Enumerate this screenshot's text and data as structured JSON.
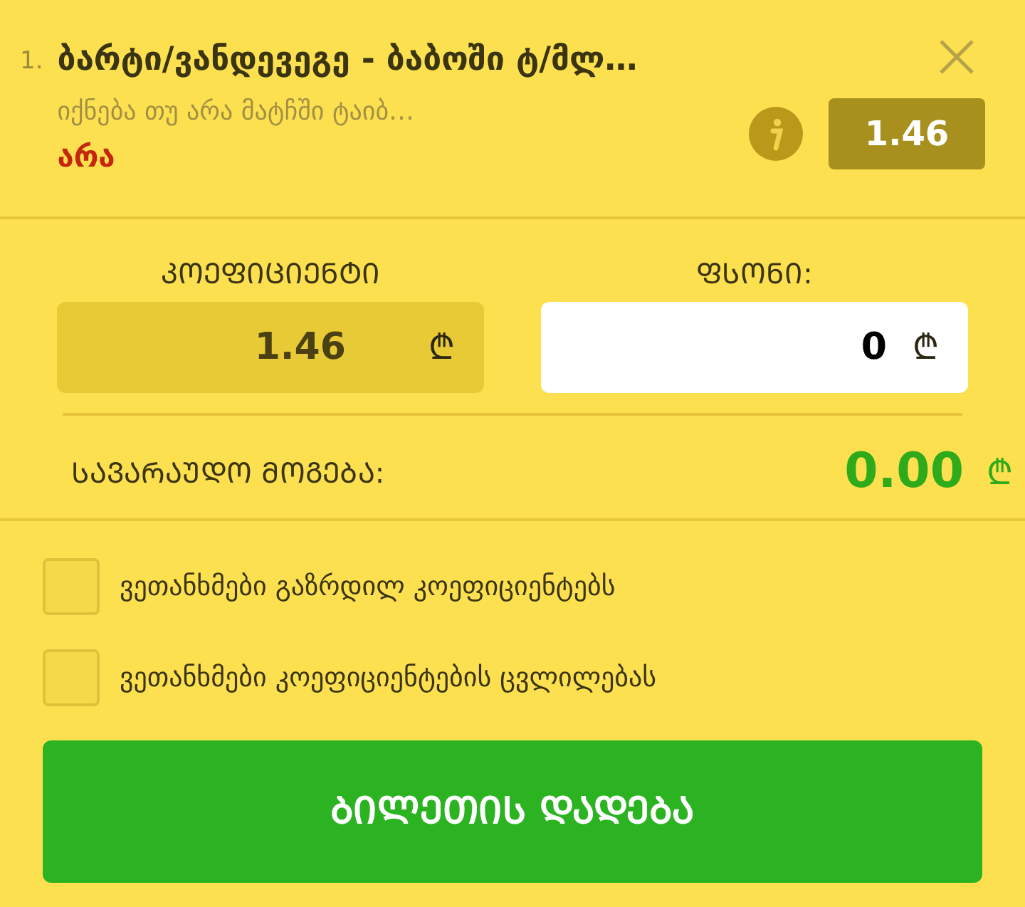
{
  "bet": {
    "number": "1.",
    "title": "ბარტი/ვანდევეგე - ბაბოში ტ/მლ…",
    "market": "იქნება თუ არა მატჩში ტაიბ…",
    "selection": "არა",
    "odds": "1.46"
  },
  "stake_form": {
    "odds_label": "ᲙᲝᲔᲤᲘᲪᲘᲔᲜᲢᲘ",
    "odds_value": "1.46",
    "odds_currency": "₾",
    "stake_label": "ᲤᲡᲝᲜᲘ:",
    "stake_value": "0",
    "stake_currency": "₾",
    "win_label": "ᲡᲐᲕᲐᲠᲐᲣᲓᲝ ᲛᲝᲒᲔᲑᲐ:",
    "win_value": "0.00",
    "win_currency": "₾"
  },
  "options": [
    {
      "label": "ვეთანხმები გაზრდილ კოეფიციენტებს",
      "checked": false
    },
    {
      "label": "ვეთანხმები კოეფიციენტების ცვლილებას",
      "checked": false
    }
  ],
  "submit_button": "ᲑᲘᲚᲔᲗᲘᲡ ᲓᲐᲓᲔᲑᲐ"
}
